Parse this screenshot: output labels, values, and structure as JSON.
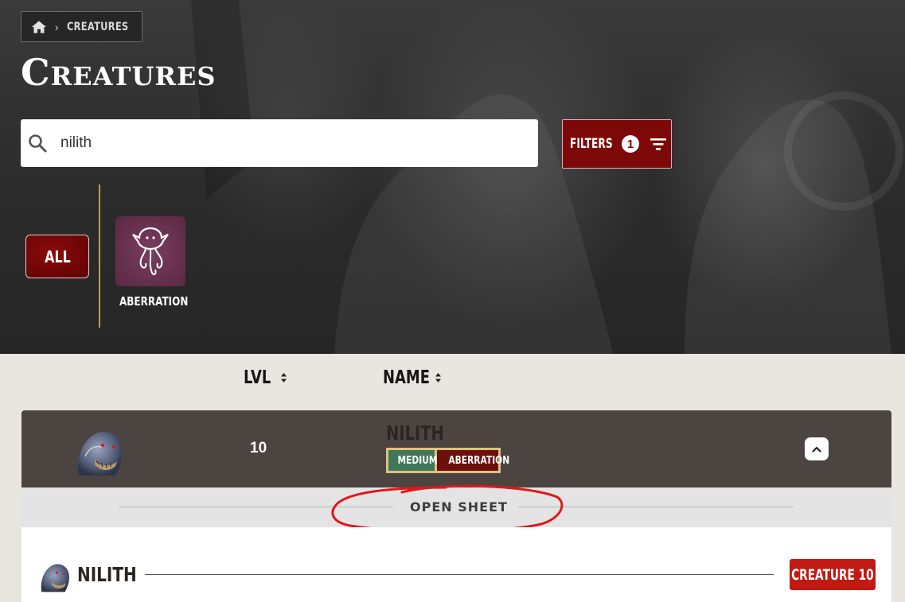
{
  "breadcrumb": {
    "current": "CREATURES",
    "separator": "›",
    "home_icon": "home-icon"
  },
  "page": {
    "title": "Creatures"
  },
  "search": {
    "value": "nilith",
    "icon": "search-icon"
  },
  "filters": {
    "label": "FILTERS",
    "count": "1",
    "icon": "filter-icon"
  },
  "categories": {
    "all_label": "ALL",
    "items": [
      {
        "label": "ABERRATION",
        "icon": "aberration-icon"
      }
    ]
  },
  "table": {
    "columns": [
      {
        "label": "LVL",
        "icon": "sort-icon"
      },
      {
        "label": "NAME",
        "icon": "sort-icon"
      }
    ],
    "rows": [
      {
        "level": "10",
        "name": "NILITH",
        "traits": [
          "MEDIUM",
          "ABERRATION"
        ],
        "avatar": "nilith-avatar"
      }
    ]
  },
  "open_sheet": {
    "label": "OPEN SHEET"
  },
  "detail": {
    "title": "NILITH",
    "badge": "CREATURE 10"
  },
  "colors": {
    "accent": "#7d0808",
    "trait_size": "#3f7859",
    "trait_type": "#6c0f0d",
    "trait_frame": "#dfc17f",
    "badge": "#c01a12",
    "annotation": "#e11717"
  }
}
